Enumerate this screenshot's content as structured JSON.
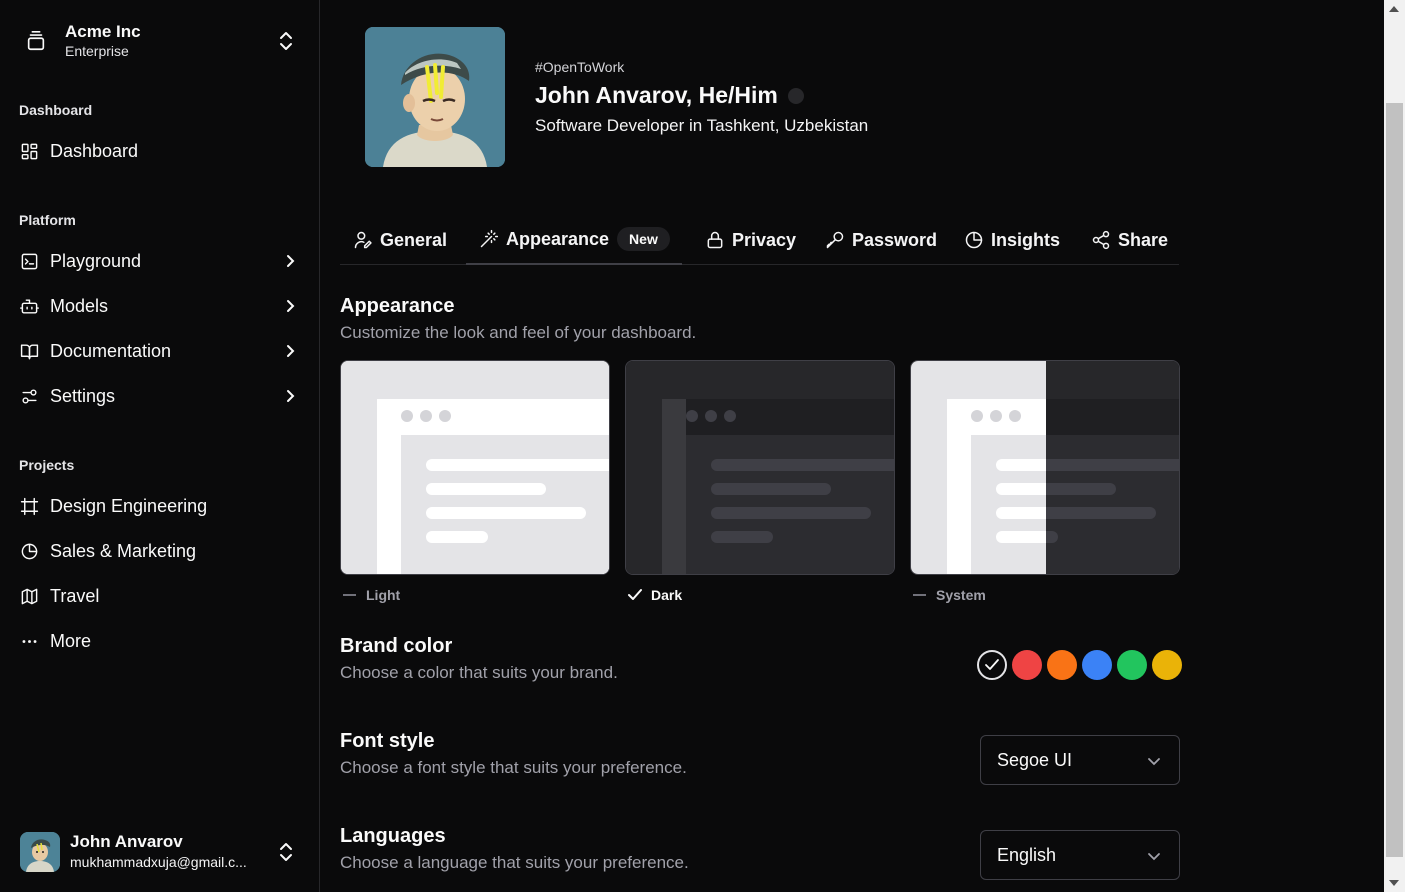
{
  "team": {
    "name": "Acme Inc",
    "plan": "Enterprise",
    "logo_icon": "layers-icon"
  },
  "sidebar": {
    "groups": [
      {
        "label": "Dashboard",
        "items": [
          {
            "label": "Dashboard",
            "icon": "grid-icon"
          }
        ]
      },
      {
        "label": "Platform",
        "items": [
          {
            "label": "Playground",
            "icon": "terminal-icon"
          },
          {
            "label": "Models",
            "icon": "bot-icon"
          },
          {
            "label": "Documentation",
            "icon": "book-icon"
          },
          {
            "label": "Settings",
            "icon": "sliders-icon"
          }
        ]
      },
      {
        "label": "Projects",
        "items": [
          {
            "label": "Design Engineering",
            "icon": "frame-icon"
          },
          {
            "label": "Sales & Marketing",
            "icon": "pie-chart-icon"
          },
          {
            "label": "Travel",
            "icon": "map-icon"
          },
          {
            "label": "More",
            "icon": "more-horizontal-icon"
          }
        ]
      }
    ]
  },
  "user": {
    "name": "John Anvarov",
    "email": "mukhammadxuja@gmail.c..."
  },
  "profile": {
    "tag": "#OpenToWork",
    "name": "John Anvarov, He/Him",
    "role": "Software Developer in Tashkent, Uzbekistan"
  },
  "tabs": [
    {
      "label": "General",
      "icon": "user-pen-icon",
      "active": false
    },
    {
      "label": "Appearance",
      "icon": "wand-icon",
      "active": true,
      "badge": "New"
    },
    {
      "label": "Privacy",
      "icon": "lock-icon",
      "active": false
    },
    {
      "label": "Password",
      "icon": "key-icon",
      "active": false
    },
    {
      "label": "Insights",
      "icon": "pie-chart-icon",
      "active": false
    },
    {
      "label": "Share",
      "icon": "share-icon",
      "active": false
    }
  ],
  "appearance": {
    "title": "Appearance",
    "description": "Customize the look and feel of your dashboard.",
    "themes": [
      {
        "label": "Light",
        "selected": false
      },
      {
        "label": "Dark",
        "selected": true
      },
      {
        "label": "System",
        "selected": false
      }
    ]
  },
  "brand": {
    "title": "Brand color",
    "description": "Choose a color that suits your brand.",
    "colors": [
      "#0a0a0b",
      "#ef4444",
      "#f97316",
      "#3b82f6",
      "#22c55e",
      "#eab308"
    ],
    "selected_index": 0
  },
  "font": {
    "title": "Font style",
    "description": "Choose a font style that suits your preference.",
    "value": "Segoe UI"
  },
  "language": {
    "title": "Languages",
    "description": "Choose a language that suits your preference.",
    "value": "English"
  }
}
